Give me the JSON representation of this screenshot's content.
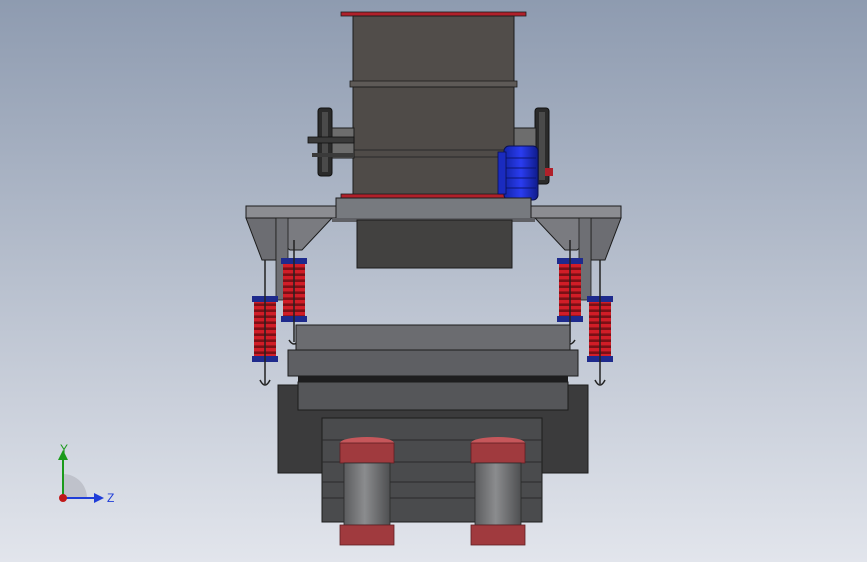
{
  "viewport": {
    "background_top": "#8e9bb0",
    "background_bottom": "#e2e5ec"
  },
  "colors": {
    "body_dark": "#4f4b48",
    "body_mid": "#5d5955",
    "frame_gray": "#7a7b7f",
    "frame_light": "#9a9ba0",
    "spring_red": "#c11a23",
    "spring_blue": "#1e2a8c",
    "motor_blue": "#1b2ad0",
    "drum_red": "#a03a3e",
    "drum_gray": "#767779",
    "trim_red": "#b0202a",
    "outline": "#1c1c1c"
  },
  "triad": {
    "y_label": "Y",
    "z_label": "Z",
    "y_color": "#1b9a1b",
    "z_color": "#1f3dd8",
    "origin_color": "#c01818"
  }
}
